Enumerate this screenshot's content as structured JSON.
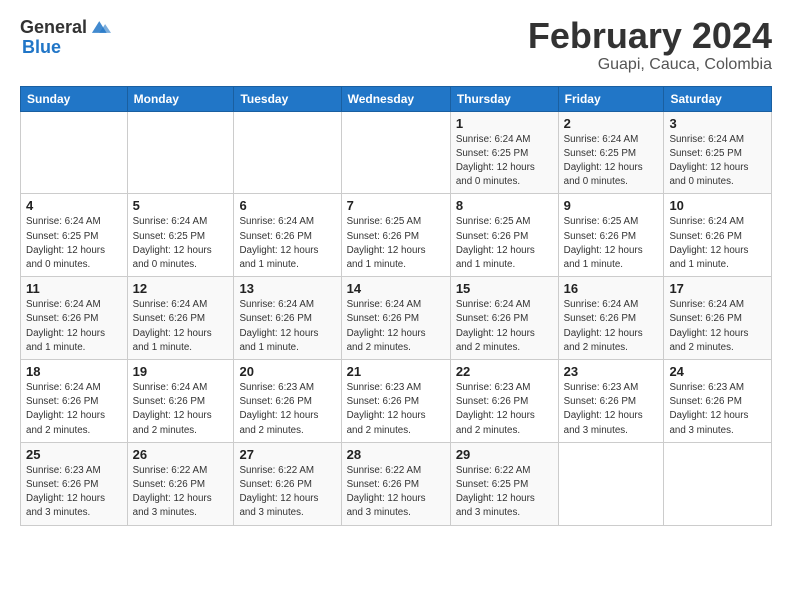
{
  "logo": {
    "text_general": "General",
    "text_blue": "Blue"
  },
  "title": "February 2024",
  "subtitle": "Guapi, Cauca, Colombia",
  "days_of_week": [
    "Sunday",
    "Monday",
    "Tuesday",
    "Wednesday",
    "Thursday",
    "Friday",
    "Saturday"
  ],
  "weeks": [
    [
      {
        "day": "",
        "info": ""
      },
      {
        "day": "",
        "info": ""
      },
      {
        "day": "",
        "info": ""
      },
      {
        "day": "",
        "info": ""
      },
      {
        "day": "1",
        "info": "Sunrise: 6:24 AM\nSunset: 6:25 PM\nDaylight: 12 hours\nand 0 minutes."
      },
      {
        "day": "2",
        "info": "Sunrise: 6:24 AM\nSunset: 6:25 PM\nDaylight: 12 hours\nand 0 minutes."
      },
      {
        "day": "3",
        "info": "Sunrise: 6:24 AM\nSunset: 6:25 PM\nDaylight: 12 hours\nand 0 minutes."
      }
    ],
    [
      {
        "day": "4",
        "info": "Sunrise: 6:24 AM\nSunset: 6:25 PM\nDaylight: 12 hours\nand 0 minutes."
      },
      {
        "day": "5",
        "info": "Sunrise: 6:24 AM\nSunset: 6:25 PM\nDaylight: 12 hours\nand 0 minutes."
      },
      {
        "day": "6",
        "info": "Sunrise: 6:24 AM\nSunset: 6:26 PM\nDaylight: 12 hours\nand 1 minute."
      },
      {
        "day": "7",
        "info": "Sunrise: 6:25 AM\nSunset: 6:26 PM\nDaylight: 12 hours\nand 1 minute."
      },
      {
        "day": "8",
        "info": "Sunrise: 6:25 AM\nSunset: 6:26 PM\nDaylight: 12 hours\nand 1 minute."
      },
      {
        "day": "9",
        "info": "Sunrise: 6:25 AM\nSunset: 6:26 PM\nDaylight: 12 hours\nand 1 minute."
      },
      {
        "day": "10",
        "info": "Sunrise: 6:24 AM\nSunset: 6:26 PM\nDaylight: 12 hours\nand 1 minute."
      }
    ],
    [
      {
        "day": "11",
        "info": "Sunrise: 6:24 AM\nSunset: 6:26 PM\nDaylight: 12 hours\nand 1 minute."
      },
      {
        "day": "12",
        "info": "Sunrise: 6:24 AM\nSunset: 6:26 PM\nDaylight: 12 hours\nand 1 minute."
      },
      {
        "day": "13",
        "info": "Sunrise: 6:24 AM\nSunset: 6:26 PM\nDaylight: 12 hours\nand 1 minute."
      },
      {
        "day": "14",
        "info": "Sunrise: 6:24 AM\nSunset: 6:26 PM\nDaylight: 12 hours\nand 2 minutes."
      },
      {
        "day": "15",
        "info": "Sunrise: 6:24 AM\nSunset: 6:26 PM\nDaylight: 12 hours\nand 2 minutes."
      },
      {
        "day": "16",
        "info": "Sunrise: 6:24 AM\nSunset: 6:26 PM\nDaylight: 12 hours\nand 2 minutes."
      },
      {
        "day": "17",
        "info": "Sunrise: 6:24 AM\nSunset: 6:26 PM\nDaylight: 12 hours\nand 2 minutes."
      }
    ],
    [
      {
        "day": "18",
        "info": "Sunrise: 6:24 AM\nSunset: 6:26 PM\nDaylight: 12 hours\nand 2 minutes."
      },
      {
        "day": "19",
        "info": "Sunrise: 6:24 AM\nSunset: 6:26 PM\nDaylight: 12 hours\nand 2 minutes."
      },
      {
        "day": "20",
        "info": "Sunrise: 6:23 AM\nSunset: 6:26 PM\nDaylight: 12 hours\nand 2 minutes."
      },
      {
        "day": "21",
        "info": "Sunrise: 6:23 AM\nSunset: 6:26 PM\nDaylight: 12 hours\nand 2 minutes."
      },
      {
        "day": "22",
        "info": "Sunrise: 6:23 AM\nSunset: 6:26 PM\nDaylight: 12 hours\nand 2 minutes."
      },
      {
        "day": "23",
        "info": "Sunrise: 6:23 AM\nSunset: 6:26 PM\nDaylight: 12 hours\nand 3 minutes."
      },
      {
        "day": "24",
        "info": "Sunrise: 6:23 AM\nSunset: 6:26 PM\nDaylight: 12 hours\nand 3 minutes."
      }
    ],
    [
      {
        "day": "25",
        "info": "Sunrise: 6:23 AM\nSunset: 6:26 PM\nDaylight: 12 hours\nand 3 minutes."
      },
      {
        "day": "26",
        "info": "Sunrise: 6:22 AM\nSunset: 6:26 PM\nDaylight: 12 hours\nand 3 minutes."
      },
      {
        "day": "27",
        "info": "Sunrise: 6:22 AM\nSunset: 6:26 PM\nDaylight: 12 hours\nand 3 minutes."
      },
      {
        "day": "28",
        "info": "Sunrise: 6:22 AM\nSunset: 6:26 PM\nDaylight: 12 hours\nand 3 minutes."
      },
      {
        "day": "29",
        "info": "Sunrise: 6:22 AM\nSunset: 6:25 PM\nDaylight: 12 hours\nand 3 minutes."
      },
      {
        "day": "",
        "info": ""
      },
      {
        "day": "",
        "info": ""
      }
    ]
  ]
}
